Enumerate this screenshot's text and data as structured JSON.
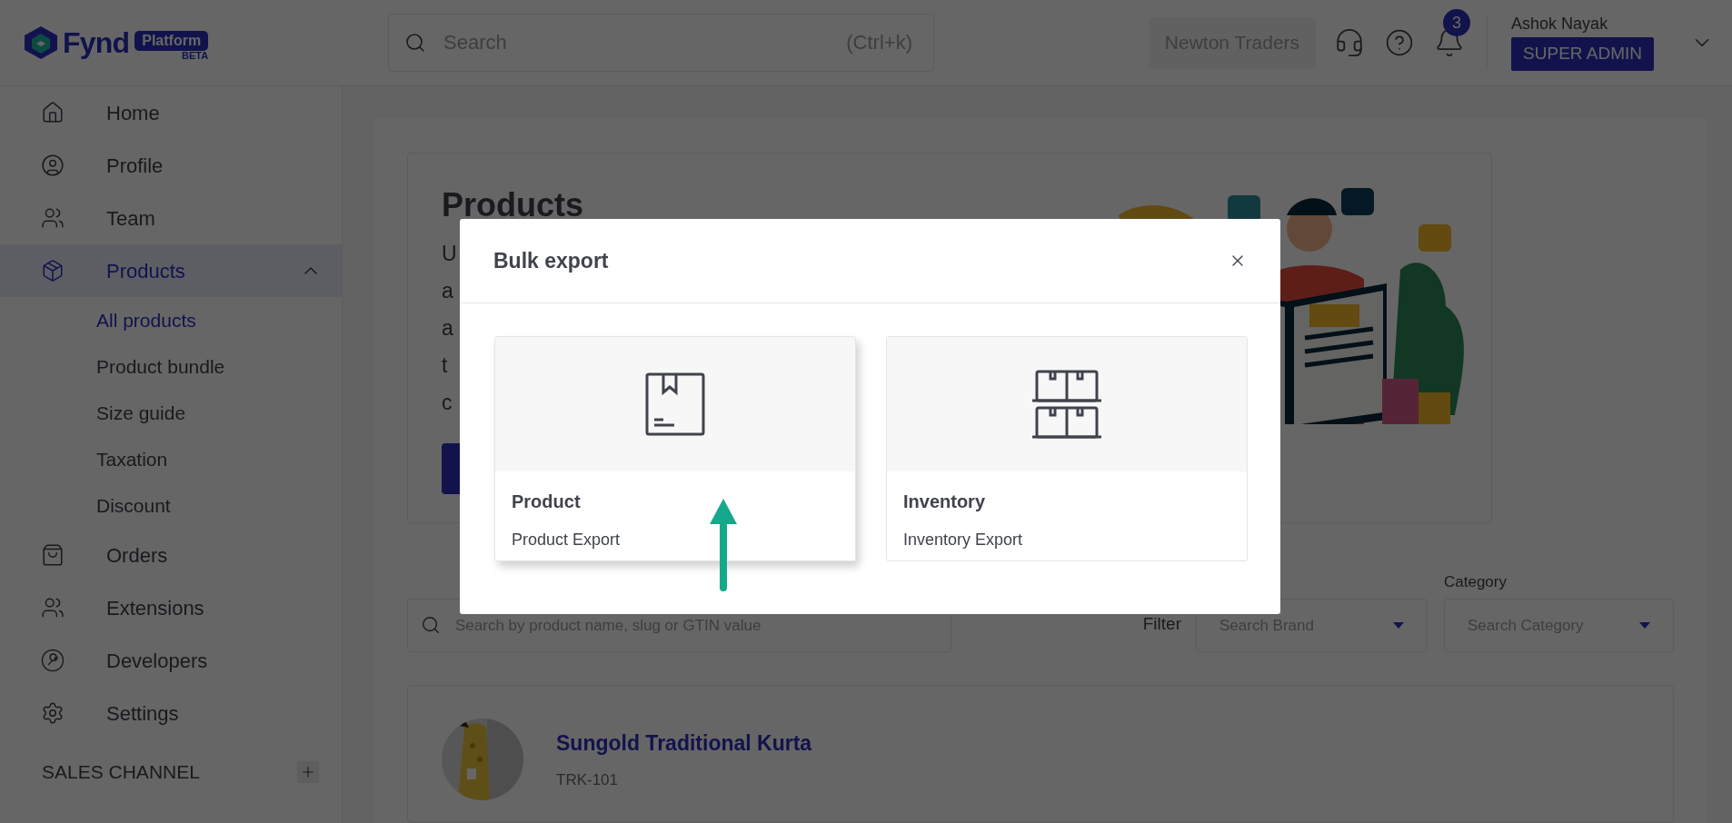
{
  "top_bar": {
    "logo": {
      "wordmark": "Fynd",
      "badge": "Platform",
      "tag": "BETA"
    },
    "search": {
      "placeholder": "Search",
      "shortcut": "(Ctrl+k)"
    },
    "company_button": "Newton Traders",
    "notifications": {
      "count": "3"
    },
    "user": {
      "name": "Ashok Nayak",
      "role": "SUPER ADMIN"
    }
  },
  "sidebar": {
    "items": [
      {
        "kind": "home",
        "label": "Home",
        "selected": false
      },
      {
        "kind": "profile",
        "label": "Profile",
        "selected": false
      },
      {
        "kind": "team",
        "label": "Team",
        "selected": false
      },
      {
        "kind": "products",
        "label": "Products",
        "selected": true,
        "expanded": true,
        "children": [
          {
            "label": "All products",
            "selected": true
          },
          {
            "label": "Product bundle",
            "selected": false
          },
          {
            "label": "Size guide",
            "selected": false
          },
          {
            "label": "Taxation",
            "selected": false
          },
          {
            "label": "Discount",
            "selected": false
          }
        ]
      },
      {
        "kind": "orders",
        "label": "Orders",
        "selected": false
      },
      {
        "kind": "extensions",
        "label": "Extensions",
        "selected": false
      },
      {
        "kind": "developers",
        "label": "Developers",
        "selected": false
      },
      {
        "kind": "settings",
        "label": "Settings",
        "selected": false
      }
    ],
    "section": {
      "label": "SALES CHANNEL"
    }
  },
  "page": {
    "title": "Products",
    "description_lines": [
      "U",
      "a",
      "a",
      "t",
      "c"
    ],
    "search": {
      "placeholder": "Search by product name, slug or GTIN value"
    },
    "filter_label": "Filter",
    "brand": {
      "placeholder": "Search Brand"
    },
    "category": {
      "label": "Category",
      "placeholder": "Search Category"
    },
    "products": [
      {
        "name": "Sungold Traditional Kurta",
        "code": "TRK-101"
      }
    ]
  },
  "modal": {
    "title": "Bulk export",
    "options": [
      {
        "kind": "product",
        "title": "Product",
        "subtitle": "Product Export",
        "selected": true
      },
      {
        "kind": "inventory",
        "title": "Inventory",
        "subtitle": "Inventory Export",
        "selected": false
      }
    ]
  }
}
